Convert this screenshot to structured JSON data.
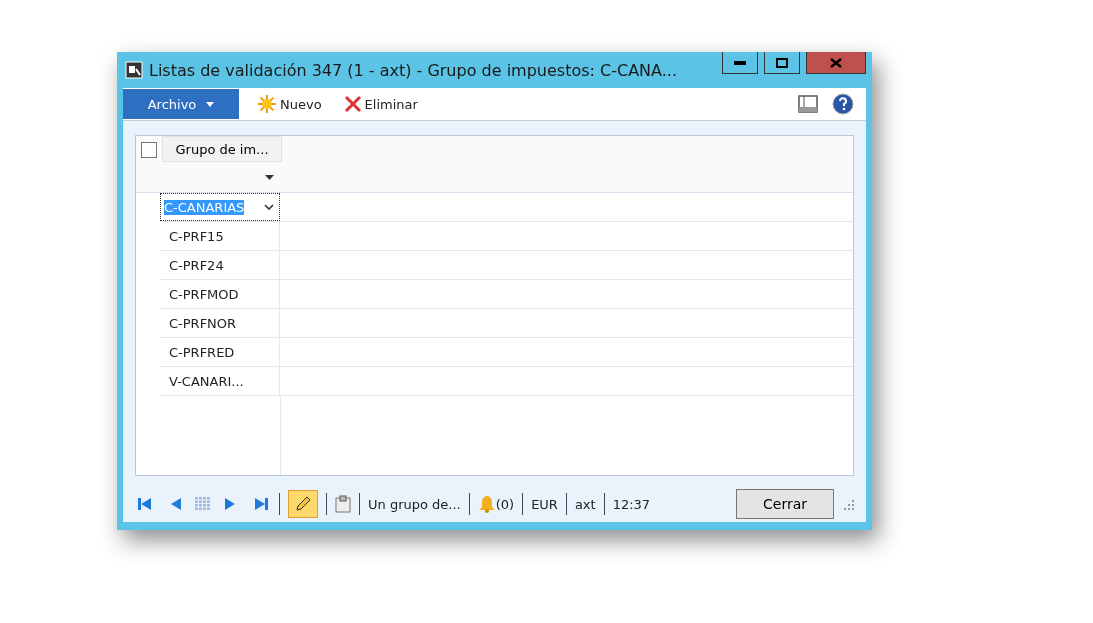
{
  "window": {
    "title": "Listas de validación 347 (1 - axt) - Grupo de impuestos: C-CANA..."
  },
  "toolbar": {
    "file_menu": "Archivo",
    "buttons": [
      {
        "kind": "new",
        "label": "Nuevo"
      },
      {
        "kind": "delete",
        "label": "Eliminar"
      }
    ]
  },
  "grid": {
    "select_all_checked": false,
    "columns": [
      "Grupo de im..."
    ],
    "rows": [
      {
        "value": "C-CANARIAS",
        "selected": true
      },
      {
        "value": "C-PRF15",
        "selected": false
      },
      {
        "value": "C-PRF24",
        "selected": false
      },
      {
        "value": "C-PRFMOD",
        "selected": false
      },
      {
        "value": "C-PRFNOR",
        "selected": false
      },
      {
        "value": "C-PRFRED",
        "selected": false
      },
      {
        "value": "V-CANARI...",
        "selected": false
      }
    ]
  },
  "status_bar": {
    "edit_mode": true,
    "description": "Un grupo de...",
    "notifications": "(0)",
    "currency": "EUR",
    "company": "axt",
    "time": "12:37",
    "close_button": "Cerrar"
  }
}
